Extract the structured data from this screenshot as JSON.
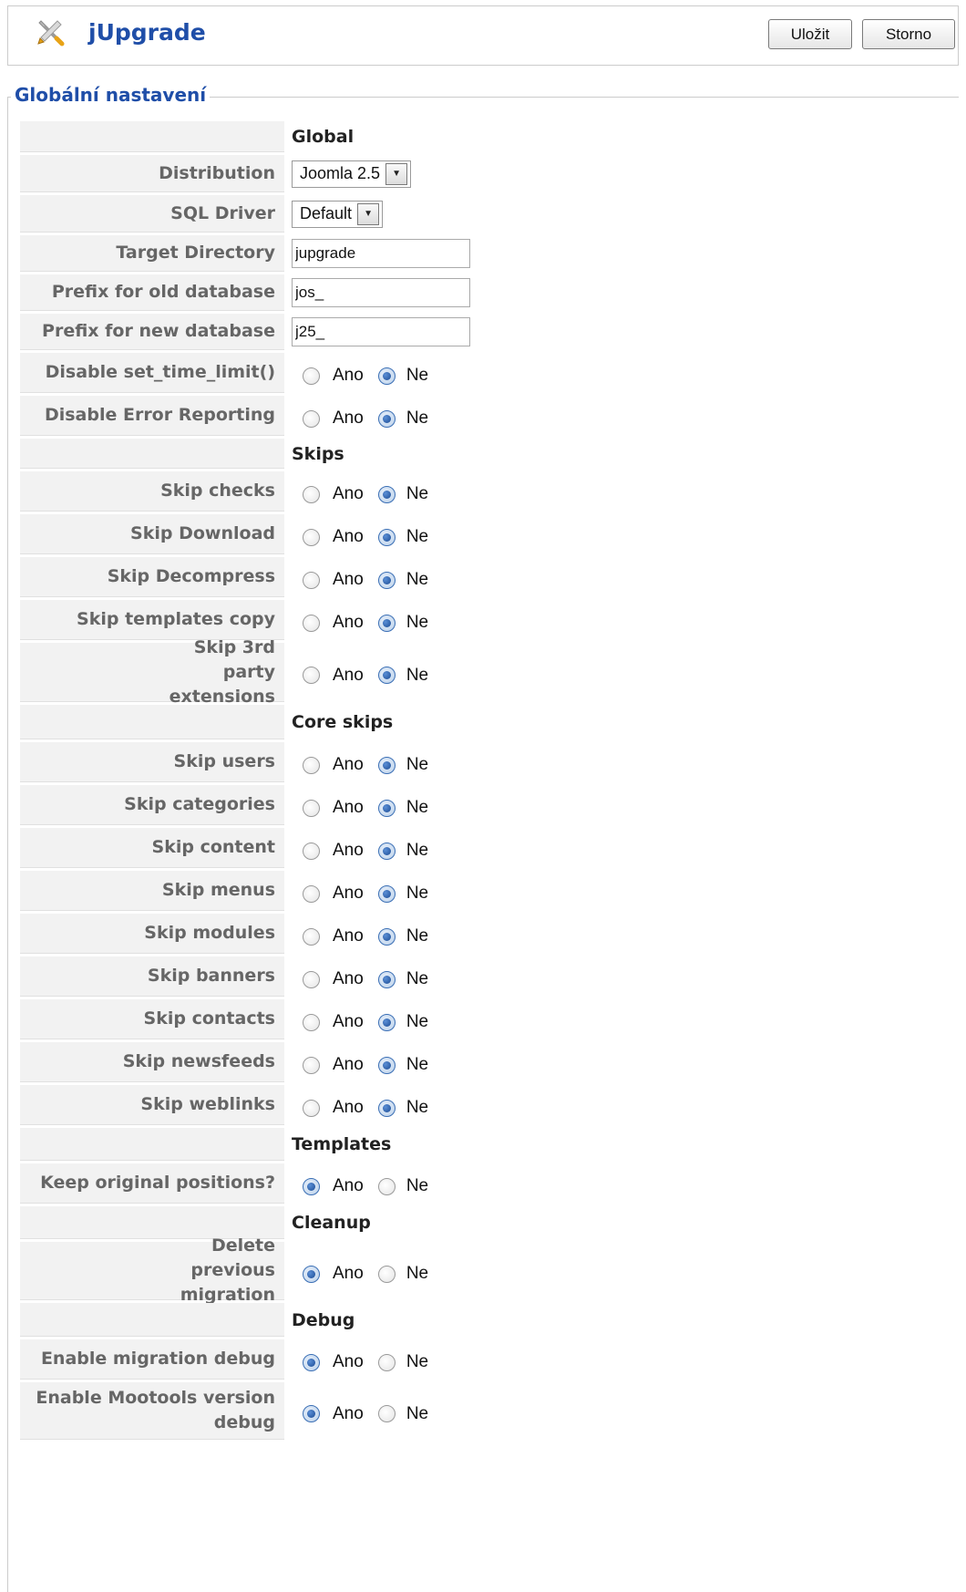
{
  "header": {
    "title": "jUpgrade",
    "icon": "wrench-icon",
    "save_label": "Uložit",
    "cancel_label": "Storno"
  },
  "fieldset": {
    "legend": "Globální nastavení"
  },
  "sections": {
    "global": "Global",
    "skips": "Skips",
    "core_skips": "Core skips",
    "templates": "Templates",
    "cleanup": "Cleanup",
    "debug": "Debug"
  },
  "radio_labels": {
    "yes": "Ano",
    "no": "Ne"
  },
  "fields": {
    "distribution": {
      "label": "Distribution",
      "value": "Joomla 2.5"
    },
    "sql_driver": {
      "label": "SQL Driver",
      "value": "Default"
    },
    "target_directory": {
      "label": "Target Directory",
      "value": "jupgrade"
    },
    "prefix_old": {
      "label": "Prefix for old database",
      "value": "jos_"
    },
    "prefix_new": {
      "label": "Prefix for new database",
      "value": "j25_"
    },
    "disable_time_limit": {
      "label": "Disable set_time_limit()",
      "selected": "Ne"
    },
    "disable_error_reporting": {
      "label": "Disable Error Reporting",
      "selected": "Ne"
    },
    "skip_checks": {
      "label": "Skip checks",
      "selected": "Ne"
    },
    "skip_download": {
      "label": "Skip Download",
      "selected": "Ne"
    },
    "skip_decompress": {
      "label": "Skip Decompress",
      "selected": "Ne"
    },
    "skip_templates_copy": {
      "label": "Skip templates copy",
      "selected": "Ne"
    },
    "skip_3rd_party": {
      "label": "Skip 3rd party extensions",
      "selected": "Ne"
    },
    "skip_users": {
      "label": "Skip users",
      "selected": "Ne"
    },
    "skip_categories": {
      "label": "Skip categories",
      "selected": "Ne"
    },
    "skip_content": {
      "label": "Skip content",
      "selected": "Ne"
    },
    "skip_menus": {
      "label": "Skip menus",
      "selected": "Ne"
    },
    "skip_modules": {
      "label": "Skip modules",
      "selected": "Ne"
    },
    "skip_banners": {
      "label": "Skip banners",
      "selected": "Ne"
    },
    "skip_contacts": {
      "label": "Skip contacts",
      "selected": "Ne"
    },
    "skip_newsfeeds": {
      "label": "Skip newsfeeds",
      "selected": "Ne"
    },
    "skip_weblinks": {
      "label": "Skip weblinks",
      "selected": "Ne"
    },
    "keep_positions": {
      "label": "Keep original positions?",
      "selected": "Ano"
    },
    "delete_previous": {
      "label": "Delete previous migration",
      "selected": "Ano"
    },
    "migration_debug": {
      "label": "Enable migration debug",
      "selected": "Ano"
    },
    "mootools_debug": {
      "label": "Enable Mootools version debug",
      "selected": "Ano"
    }
  },
  "colors": {
    "title_blue": "#1f4ea8",
    "key_bg": "#f2f2f2",
    "key_text": "#666666",
    "radio_checked": "#1a4a93"
  }
}
